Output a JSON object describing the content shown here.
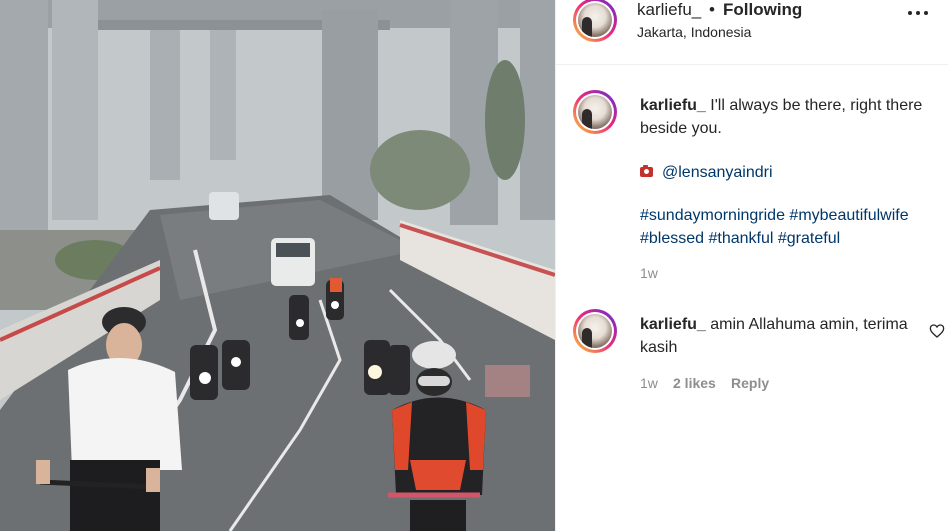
{
  "post": {
    "username": "karliefu_",
    "follow_separator": "•",
    "follow_status": "Following",
    "location": "Jakarta, Indonesia",
    "more_icon": "more-horizontal-icon"
  },
  "caption": {
    "username": "karliefu_",
    "text": "I'll always be there, right there beside you.",
    "credit_icon": "camera-icon",
    "credit": "@lensanyaindri",
    "hashtags_line1": "#sundaymorningride #mybeautifulwife",
    "hashtags_line2": "#blessed #thankful #grateful",
    "time": "1w"
  },
  "comments": [
    {
      "username": "karliefu_",
      "text": "amin Allahuma amin, terima kasih",
      "time": "1w",
      "likes": "2 likes",
      "reply_label": "Reply",
      "like_icon": "heart-outline-icon"
    }
  ],
  "colors": {
    "text": "#262626",
    "muted": "#8e8e8e",
    "hashtag": "#00376b",
    "divider": "#efefef"
  }
}
